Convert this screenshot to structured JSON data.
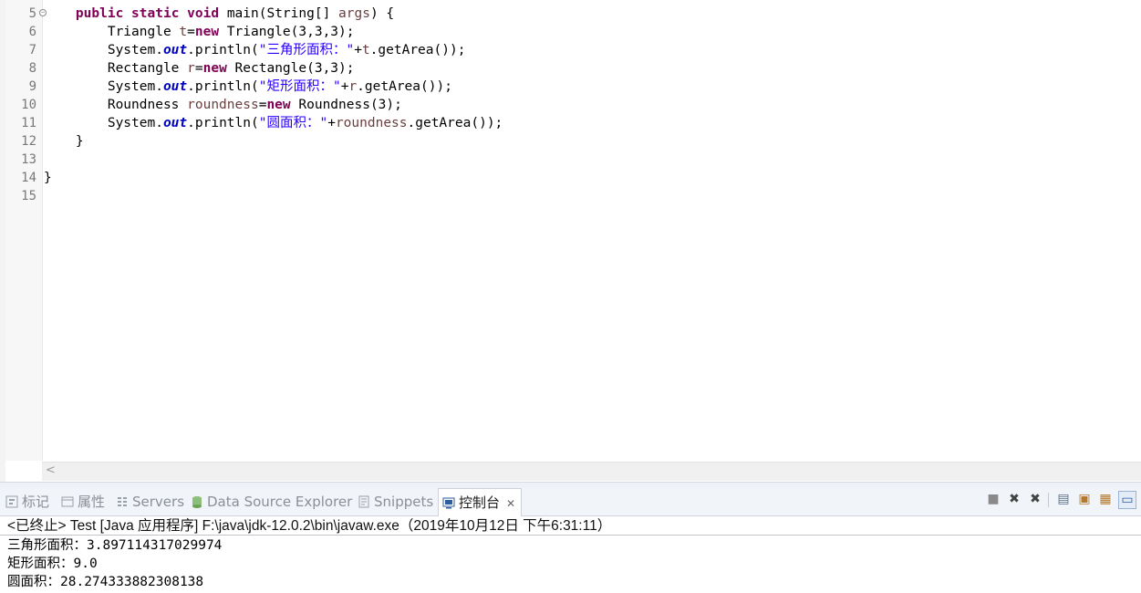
{
  "editor": {
    "line_numbers": [
      "5",
      "6",
      "7",
      "8",
      "9",
      "10",
      "11",
      "12",
      "13",
      "14",
      "15"
    ],
    "fold_marker_line": "5",
    "lines": [
      [
        {
          "t": "    "
        },
        {
          "t": "public",
          "c": "kw"
        },
        {
          "t": " "
        },
        {
          "t": "static",
          "c": "kw"
        },
        {
          "t": " "
        },
        {
          "t": "void",
          "c": "kw"
        },
        {
          "t": " main(String[] "
        },
        {
          "t": "args",
          "c": "var"
        },
        {
          "t": ") {"
        }
      ],
      [
        {
          "t": "        Triangle "
        },
        {
          "t": "t",
          "c": "var"
        },
        {
          "t": "="
        },
        {
          "t": "new",
          "c": "kw"
        },
        {
          "t": " Triangle(3,3,3);"
        }
      ],
      [
        {
          "t": "        System."
        },
        {
          "t": "out",
          "c": "fld"
        },
        {
          "t": ".println("
        },
        {
          "t": "\"三角形面积：\"",
          "c": "str"
        },
        {
          "t": "+"
        },
        {
          "t": "t",
          "c": "var"
        },
        {
          "t": ".getArea());"
        }
      ],
      [
        {
          "t": "        Rectangle "
        },
        {
          "t": "r",
          "c": "var"
        },
        {
          "t": "="
        },
        {
          "t": "new",
          "c": "kw"
        },
        {
          "t": " Rectangle(3,3);"
        }
      ],
      [
        {
          "t": "        System."
        },
        {
          "t": "out",
          "c": "fld"
        },
        {
          "t": ".println("
        },
        {
          "t": "\"矩形面积：\"",
          "c": "str"
        },
        {
          "t": "+"
        },
        {
          "t": "r",
          "c": "var"
        },
        {
          "t": ".getArea());"
        }
      ],
      [
        {
          "t": "        Roundness "
        },
        {
          "t": "roundness",
          "c": "var"
        },
        {
          "t": "="
        },
        {
          "t": "new",
          "c": "kw"
        },
        {
          "t": " Roundness(3);"
        }
      ],
      [
        {
          "t": "        System."
        },
        {
          "t": "out",
          "c": "fld"
        },
        {
          "t": ".println("
        },
        {
          "t": "\"圆面积：\"",
          "c": "str"
        },
        {
          "t": "+"
        },
        {
          "t": "roundness",
          "c": "var"
        },
        {
          "t": ".getArea());"
        }
      ],
      [
        {
          "t": "    }"
        }
      ],
      [
        {
          "t": ""
        }
      ],
      [
        {
          "t": "}"
        }
      ],
      [
        {
          "t": ""
        }
      ]
    ]
  },
  "tabs": {
    "markers": "标记",
    "properties": "属性",
    "servers": "Servers",
    "data_source_explorer": "Data Source Explorer",
    "snippets": "Snippets",
    "console": "控制台",
    "close": "✕"
  },
  "toolbar": {
    "terminate_icon": "■",
    "remove_launch_icon": "✖",
    "remove_all_icon": "✖",
    "scroll_lock_icon": "▤",
    "show_on_output_icon": "▣",
    "pin_icon": "▦",
    "display_selected_icon": "▭"
  },
  "console": {
    "header": "<已终止> Test [Java 应用程序] F:\\java\\jdk-12.0.2\\bin\\javaw.exe（2019年10月12日 下午6:31:11）",
    "output": [
      "三角形面积：3.897114317029974",
      "矩形面积：9.0",
      "圆面积：28.274333882308138"
    ]
  }
}
